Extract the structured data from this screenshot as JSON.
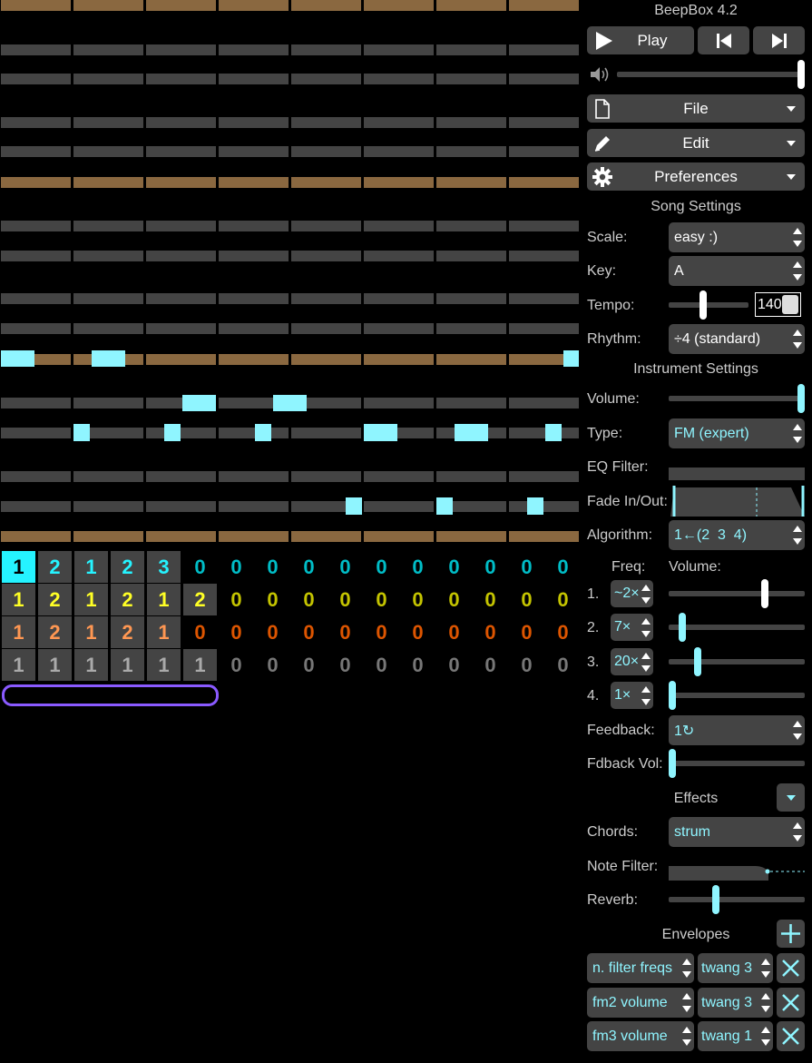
{
  "app": {
    "title": "BeepBox 4.2"
  },
  "transport": {
    "play_label": "Play"
  },
  "menus": {
    "file": "File",
    "edit": "Edit",
    "preferences": "Preferences"
  },
  "song": {
    "heading": "Song Settings",
    "scale_label": "Scale:",
    "scale_value": "easy :)",
    "key_label": "Key:",
    "key_value": "A",
    "tempo_label": "Tempo:",
    "tempo_value": "140",
    "rhythm_label": "Rhythm:",
    "rhythm_value": "÷4 (standard)"
  },
  "instrument": {
    "heading": "Instrument Settings",
    "volume_label": "Volume:",
    "type_label": "Type:",
    "type_value": "FM (expert)",
    "eq_label": "EQ Filter:",
    "fade_label": "Fade In/Out:",
    "algorithm_label": "Algorithm:",
    "algorithm_value": "1←(2  3  4)",
    "freq_header": "Freq:",
    "volume_header": "Volume:",
    "operators": [
      {
        "num": "1.",
        "freq": "~2×",
        "volume_level": 0.72
      },
      {
        "num": "2.",
        "freq": "7×",
        "volume_level": 0.08
      },
      {
        "num": "3.",
        "freq": "20×",
        "volume_level": 0.2
      },
      {
        "num": "4.",
        "freq": "1×",
        "volume_level": 0.0
      }
    ],
    "feedback_label": "Feedback:",
    "feedback_value": "1↻",
    "fdback_vol_label": "Fdback Vol:"
  },
  "effects": {
    "heading": "Effects",
    "chords_label": "Chords:",
    "chords_value": "strum",
    "note_filter_label": "Note Filter:",
    "reverb_label": "Reverb:"
  },
  "envelopes": {
    "heading": "Envelopes",
    "rows": [
      {
        "target": "n. filter freqs",
        "envelope": "twang 3"
      },
      {
        "target": "fm2 volume",
        "envelope": "twang 3"
      },
      {
        "target": "fm3 volume",
        "envelope": "twang 1"
      }
    ]
  },
  "track_editor": {
    "channels": [
      {
        "color": "#25f3ff",
        "dim": "#00bdc7",
        "values": [
          "1",
          "2",
          "1",
          "2",
          "3",
          "0",
          "0",
          "0",
          "0",
          "0",
          "0",
          "0",
          "0",
          "0",
          "0",
          "0"
        ]
      },
      {
        "color": "#ffff25",
        "dim": "#c4c400",
        "values": [
          "1",
          "2",
          "1",
          "2",
          "1",
          "2",
          "0",
          "0",
          "0",
          "0",
          "0",
          "0",
          "0",
          "0",
          "0",
          "0"
        ]
      },
      {
        "color": "#ff9752",
        "dim": "#dd5500",
        "values": [
          "1",
          "2",
          "1",
          "2",
          "1",
          "0",
          "0",
          "0",
          "0",
          "0",
          "0",
          "0",
          "0",
          "0",
          "0",
          "0"
        ]
      },
      {
        "color": "#aaaaaa",
        "dim": "#777777",
        "values": [
          "1",
          "1",
          "1",
          "1",
          "1",
          "1",
          "0",
          "0",
          "0",
          "0",
          "0",
          "0",
          "0",
          "0",
          "0",
          "0"
        ]
      }
    ]
  },
  "colors": {
    "accent": "#8ff5ff",
    "pattern_brown": "#8a6840",
    "loop": "#8a5aff"
  }
}
